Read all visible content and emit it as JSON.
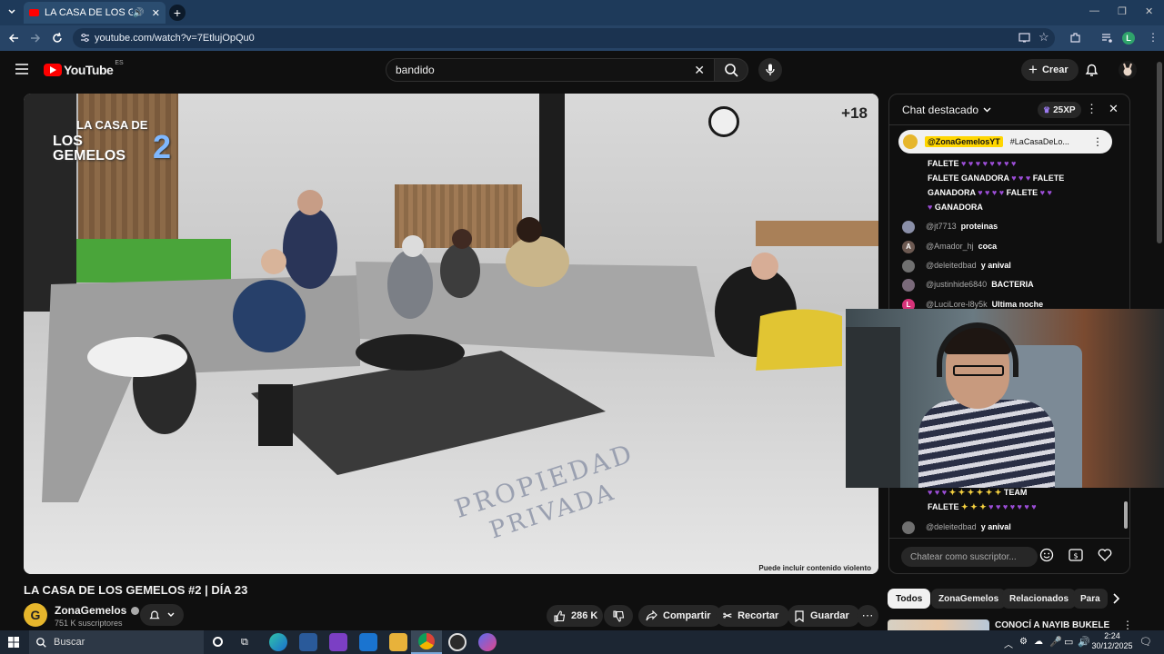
{
  "browser": {
    "tab_title": "LA CASA DE LOS GEMELOS",
    "url": "youtube.com/watch?v=7EtlujOpQu0",
    "profile_initial": "L"
  },
  "youtube": {
    "logo_text": "YouTube",
    "logo_region": "ES",
    "search_value": "bandido",
    "create_label": "Crear"
  },
  "video": {
    "rating_badge": "+18",
    "overlay_logo_line1": "LA CASA DE",
    "overlay_logo_line2": "LOS GEMELOS",
    "overlay_logo_number": "2",
    "content_warning": "Puede incluir contenido violento",
    "floor_text_1": "PROPIEDAD",
    "floor_text_2": "PRIVADA",
    "title": "LA CASA DE LOS GEMELOS #2 | DÍA 23",
    "channel_name": "ZonaGemelos",
    "channel_subs": "751 K suscriptores",
    "likes": "286 K",
    "share_label": "Compartir",
    "clip_label": "Recortar",
    "save_label": "Guardar"
  },
  "chat": {
    "header_title": "Chat destacado",
    "xp_label": "25XP",
    "pinned_author": "@ZonaGemelosYT",
    "pinned_text": "#LaCasaDeLo...",
    "top_block": {
      "line1": "FALETE",
      "line2": "FALETE GANADORA",
      "line2b": "FALETE",
      "line3": "GANADORA",
      "line3b": "FALETE",
      "line4": "GANADORA"
    },
    "messages": [
      {
        "author": "@jt7713",
        "text": "proteinas",
        "color": "#8a8fa8"
      },
      {
        "author": "@Amador_hj",
        "text": "coca",
        "color": "#6d5a52",
        "initial": "A"
      },
      {
        "author": "@deleitedbad",
        "text": "y anival",
        "color": "#707070"
      },
      {
        "author": "@justinhide6840",
        "text": "BACTERIA",
        "color": "#7a6a7a"
      },
      {
        "author": "@LuciLore-l8y5k",
        "text": "Ultima noche",
        "color": "#d6337a",
        "initial": "L"
      }
    ],
    "bottom_block": {
      "line1": "TEAM",
      "line2": "FALETE"
    },
    "last_message": {
      "author": "@deleitedbad",
      "text": "y anival"
    },
    "input_placeholder": "Chatear como suscriptor..."
  },
  "related": {
    "chips": [
      "Todos",
      "ZonaGemelos",
      "Relacionados",
      "Para"
    ],
    "first_title": "CONOCÍ A NAYIB BUKELE"
  },
  "taskbar": {
    "search_placeholder": "Buscar",
    "time": "2:24",
    "date": "30/12/2025"
  },
  "colors": {
    "youtube_red": "#ff0000",
    "chat_heart": "#9b4dd6",
    "taskbar_bg": "#1c2633"
  }
}
